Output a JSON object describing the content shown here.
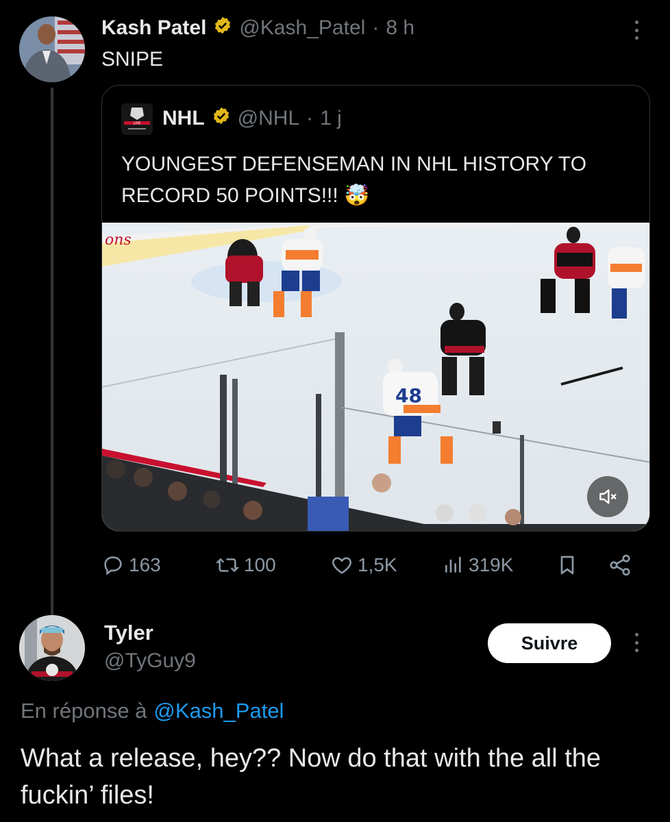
{
  "tweet": {
    "author_name": "Kash Patel",
    "handle": "@Kash_Patel",
    "separator": "·",
    "time": "8 h",
    "text": "SNIPE",
    "verified_icon": "verified-badge-icon"
  },
  "quoted": {
    "author_name": "NHL",
    "handle": "@NHL",
    "separator": "·",
    "time": "1 j",
    "text": "YOUNGEST DEFENSEMAN IN NHL HISTORY TO RECORD 50 POINTS!!! 🤯",
    "logo_text": "LIVE",
    "media_board_text": "ons",
    "player_number": "48",
    "mute_icon": "mute-icon"
  },
  "actions": {
    "replies": "163",
    "reposts": "100",
    "likes": "1,5K",
    "views": "319K"
  },
  "reply": {
    "author_name": "Tyler",
    "handle": "@TyGuy9",
    "follow_label": "Suivre",
    "in_reply_prefix": "En réponse à",
    "in_reply_handle": "@Kash_Patel",
    "text": "What a release, hey?? Now do that with the all the fuckin’ files!"
  },
  "colors": {
    "background": "#000000",
    "text": "#e7e9ea",
    "muted": "#71767b",
    "link": "#1d9bf0",
    "verified": "#e2b719"
  }
}
